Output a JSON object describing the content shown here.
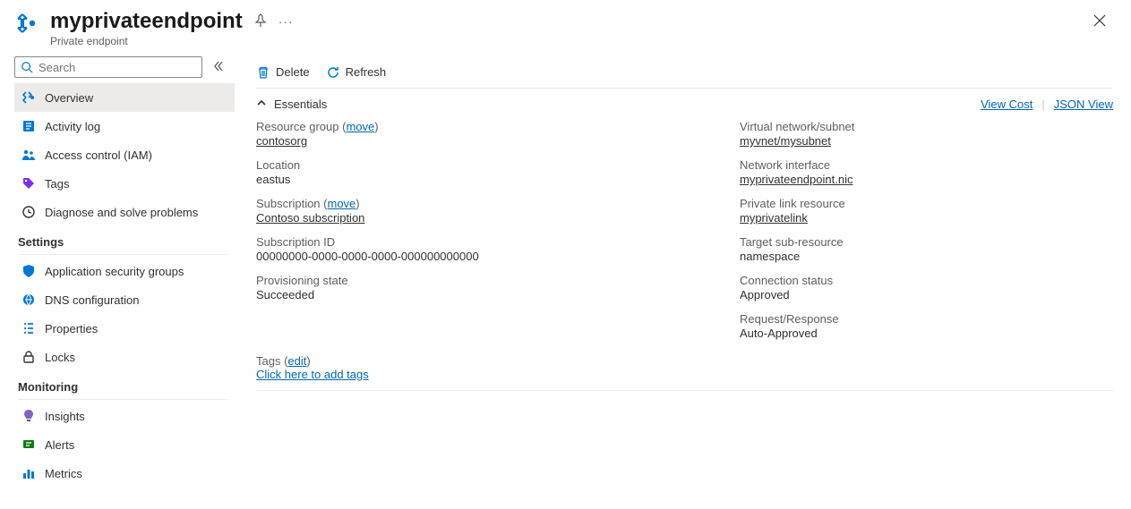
{
  "header": {
    "title": "myprivateendpoint",
    "subtitle": "Private endpoint"
  },
  "sidebar": {
    "search_placeholder": "Search",
    "items": [
      {
        "label": "Overview"
      },
      {
        "label": "Activity log"
      },
      {
        "label": "Access control (IAM)"
      },
      {
        "label": "Tags"
      },
      {
        "label": "Diagnose and solve problems"
      }
    ],
    "groups": {
      "settings": {
        "title": "Settings",
        "items": [
          {
            "label": "Application security groups"
          },
          {
            "label": "DNS configuration"
          },
          {
            "label": "Properties"
          },
          {
            "label": "Locks"
          }
        ]
      },
      "monitoring": {
        "title": "Monitoring",
        "items": [
          {
            "label": "Insights"
          },
          {
            "label": "Alerts"
          },
          {
            "label": "Metrics"
          }
        ]
      }
    }
  },
  "toolbar": {
    "delete": "Delete",
    "refresh": "Refresh"
  },
  "essentials": {
    "title": "Essentials",
    "view_cost": "View Cost",
    "json_view": "JSON View",
    "move": "move",
    "left": {
      "resource_group_k": "Resource group (",
      "resource_group_v": "contosorg",
      "location_k": "Location",
      "location_v": "eastus",
      "subscription_k": "Subscription (",
      "subscription_v": "Contoso subscription",
      "subscription_id_k": "Subscription ID",
      "subscription_id_v": "00000000-0000-0000-0000-000000000000",
      "prov_state_k": "Provisioning state",
      "prov_state_v": "Succeeded"
    },
    "right": {
      "vnet_k": "Virtual network/subnet",
      "vnet_v": "myvnet/mysubnet",
      "nic_k": "Network interface",
      "nic_v": "myprivateendpoint.nic",
      "plr_k": "Private link resource",
      "plr_v": "myprivatelink",
      "target_k": "Target sub-resource",
      "target_v": "namespace",
      "conn_k": "Connection status",
      "conn_v": "Approved",
      "req_k": "Request/Response",
      "req_v": "Auto-Approved"
    },
    "tags": {
      "k": "Tags (",
      "edit": "edit",
      "add": "Click here to add tags"
    }
  }
}
